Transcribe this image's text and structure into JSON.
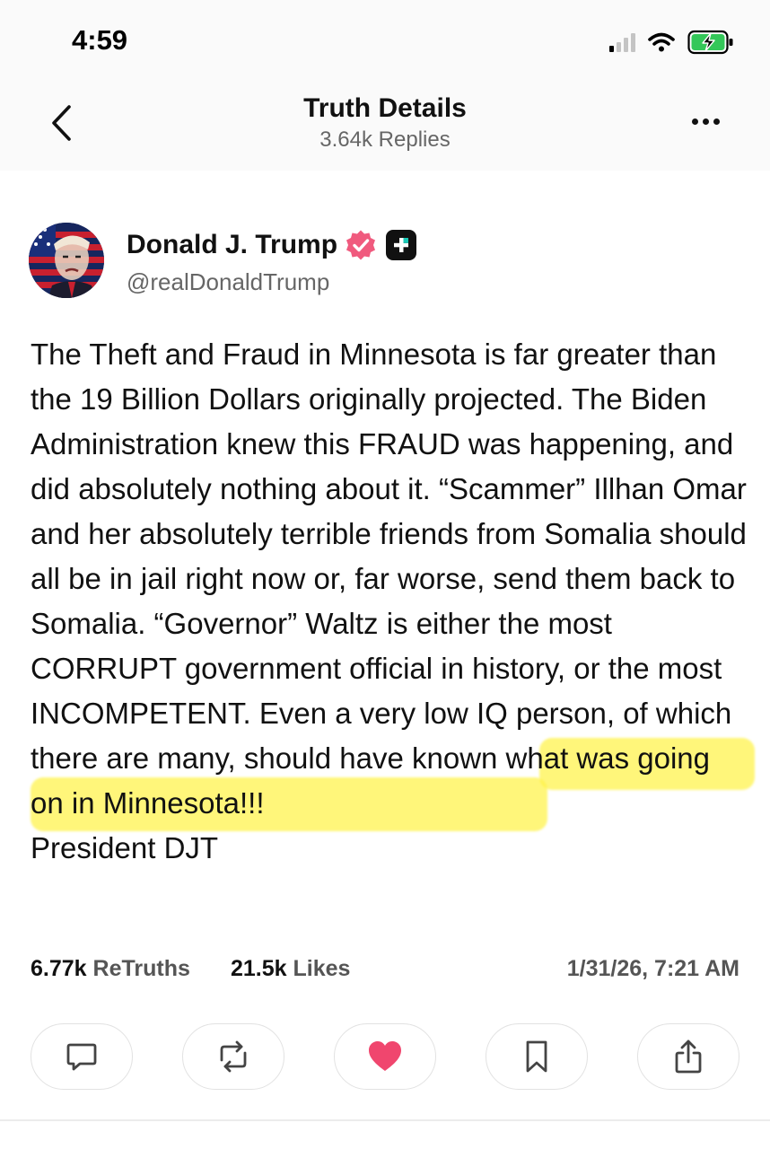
{
  "status_bar": {
    "time": "4:59"
  },
  "header": {
    "title": "Truth Details",
    "subtitle": "3.64k Replies"
  },
  "post": {
    "author_name": "Donald J. Trump",
    "author_handle": "@realDonaldTrump",
    "text": {
      "before_highlight": "The Theft and Fraud in Minnesota is far greater than the 19 Billion Dollars originally projected. The Biden Administration knew this FRAUD was happening, and did absolutely nothing about it. “Scammer” Illhan Omar and her absolutely terrible friends from Somalia should all be in jail right now or, far worse, send them back to Somalia. “Governor” Waltz is either the most CORRUPT government official in history, or the most INCOMPETENT. Even a ",
      "highlighted": "very low IQ person, of which there are many, s",
      "after_highlight": "hould have known what was going on in Minnesota!!!",
      "signature": "President DJT"
    },
    "retruths_count": "6.77k",
    "retruths_label": "ReTruths",
    "likes_count": "21.5k",
    "likes_label": "Likes",
    "timestamp": "1/31/26, 7:21 AM"
  },
  "colors": {
    "verified_badge": "#f05a7e",
    "heart": "#f0466e",
    "highlight": "#fff346",
    "text_primary": "#111111",
    "text_secondary": "#666666"
  },
  "icons": {
    "back": "chevron-left-icon",
    "more": "ellipsis-icon",
    "verified": "verified-badge-icon",
    "plus": "plus-badge-icon",
    "reply": "comment-icon",
    "retruth": "repost-icon",
    "like": "heart-icon",
    "bookmark": "bookmark-icon",
    "share": "share-icon"
  }
}
